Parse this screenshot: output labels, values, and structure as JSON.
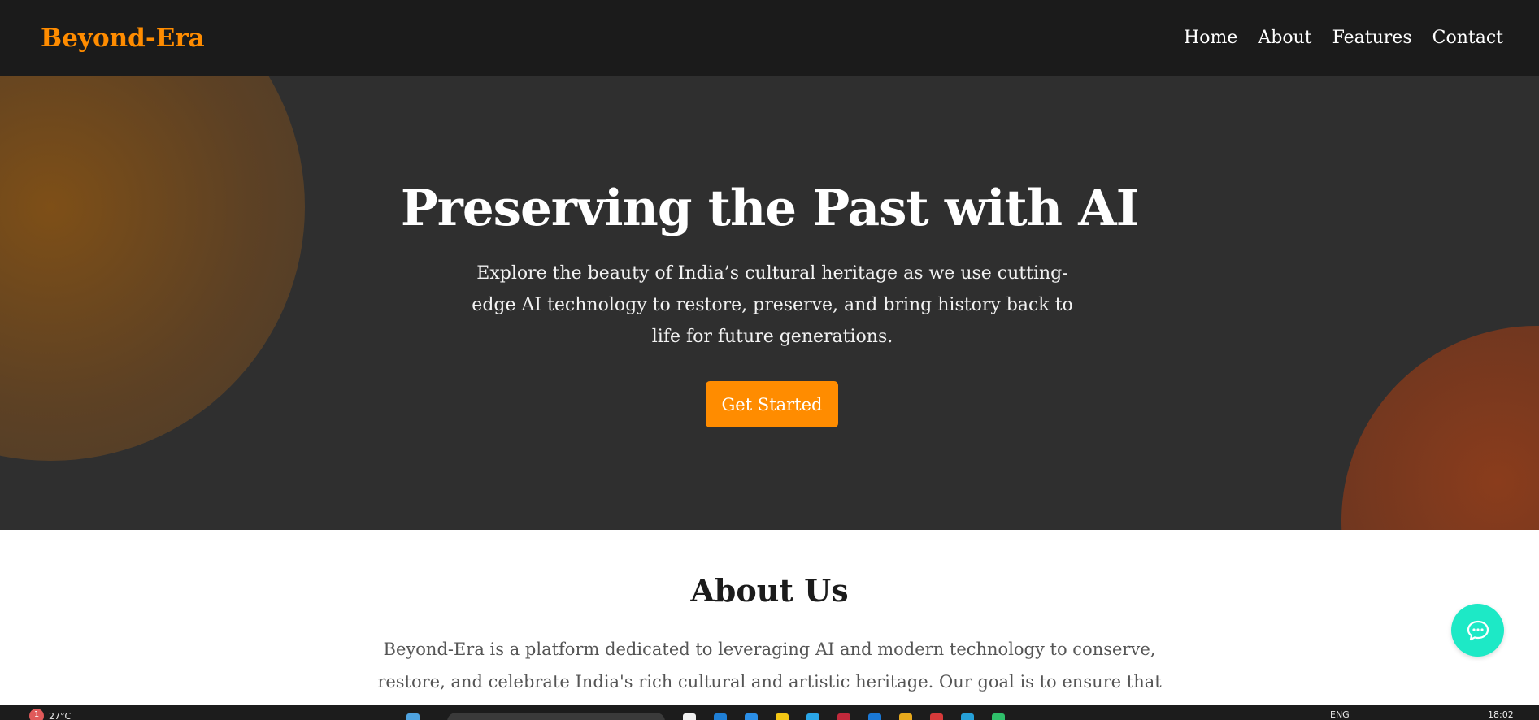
{
  "navbar": {
    "logo": "Beyond-Era",
    "links": [
      "Home",
      "About",
      "Features",
      "Contact"
    ]
  },
  "hero": {
    "title": "Preserving the Past with AI",
    "subtitle": "Explore the beauty of India’s cultural heritage as we use cutting-edge AI technology to restore, preserve, and bring history back to life for future generations.",
    "cta_label": "Get Started"
  },
  "about": {
    "title": "About Us",
    "text": "Beyond-Era is a platform dedicated to leveraging AI and modern technology to conserve, restore, and celebrate India's rich cultural and artistic heritage. Our goal is to ensure that future generations can"
  },
  "chat": {
    "icon": "chat-bubble-icon"
  },
  "taskbar": {
    "weather_badge": "1",
    "temperature": "27°C",
    "language": "ENG",
    "time": "18:02"
  },
  "colors": {
    "accent": "#ff8c00",
    "nav_bg": "#1b1b1b",
    "hero_bg": "#2f2f2f",
    "chat_bg": "#1de9c6"
  }
}
